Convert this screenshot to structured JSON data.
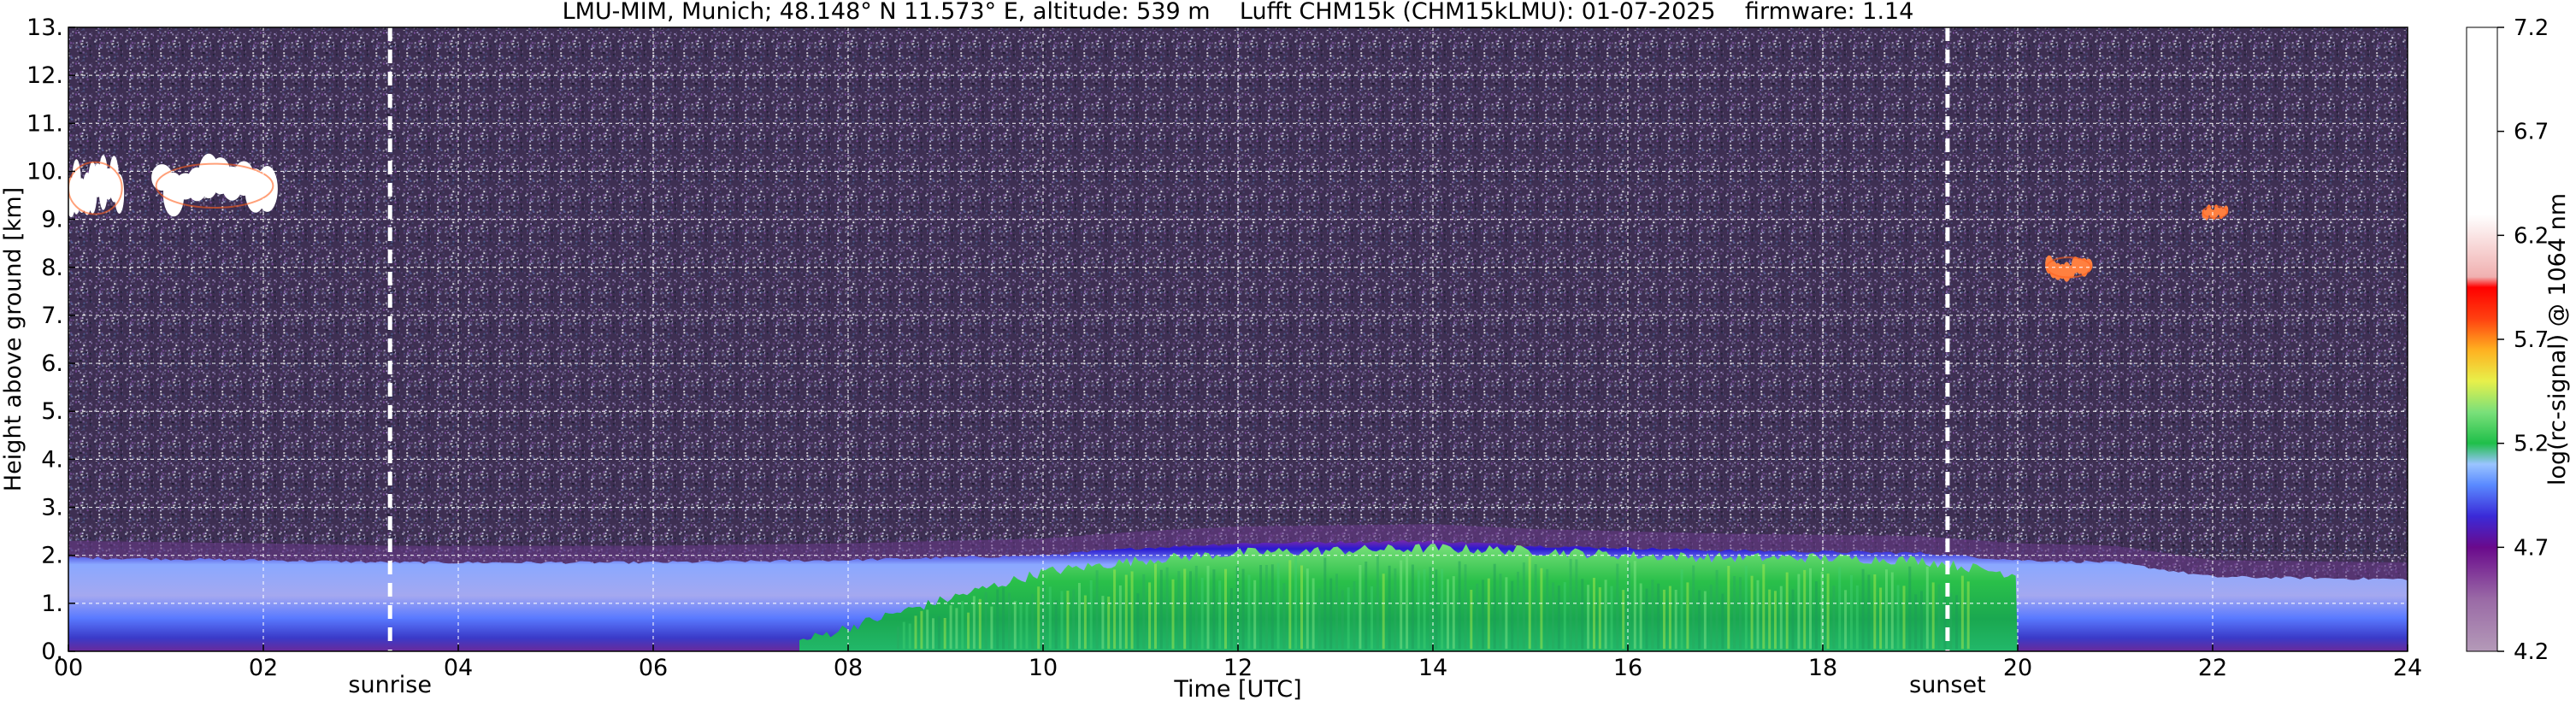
{
  "chart_data": {
    "type": "heatmap",
    "title": "LMU-MIM, Munich; 48.148° N 11.573° E, altitude: 539 m    Lufft CHM15k (CHM15kLMU): 01-07-2025    firmware: 1.14",
    "xlabel": "Time [UTC]",
    "ylabel": "Height above ground [km]",
    "colorbar_label": "log(rc-signal) @ 1064 nm",
    "xlim": [
      0,
      24
    ],
    "ylim": [
      0,
      13
    ],
    "x_ticks": [
      0,
      2,
      4,
      6,
      8,
      10,
      12,
      14,
      16,
      18,
      20,
      22,
      24
    ],
    "x_tick_labels": [
      "00",
      "02",
      "04",
      "06",
      "08",
      "10",
      "12",
      "14",
      "16",
      "18",
      "20",
      "22",
      "24"
    ],
    "y_ticks": [
      0,
      1,
      2,
      3,
      4,
      5,
      6,
      7,
      8,
      9,
      10,
      11,
      12,
      13
    ],
    "y_tick_labels": [
      "0.",
      "1.",
      "2.",
      "3.",
      "4.",
      "5.",
      "6.",
      "7.",
      "8.",
      "9.",
      "10.",
      "11.",
      "12.",
      "13."
    ],
    "grid": true,
    "colorbar": {
      "range": [
        4.2,
        7.2
      ],
      "ticks": [
        4.2,
        4.7,
        5.2,
        5.7,
        6.2,
        6.7,
        7.2
      ],
      "tick_labels": [
        "4.2",
        "4.7",
        "5.2",
        "5.7",
        "6.2",
        "6.7",
        "7.2"
      ],
      "stops": [
        {
          "value": 4.2,
          "color": "#b49ab8"
        },
        {
          "value": 4.45,
          "color": "#9a6aa6"
        },
        {
          "value": 4.7,
          "color": "#6a0a8c"
        },
        {
          "value": 4.85,
          "color": "#3a2ad8"
        },
        {
          "value": 5.0,
          "color": "#5a8aff"
        },
        {
          "value": 5.1,
          "color": "#9ac4ff"
        },
        {
          "value": 5.2,
          "color": "#1fbf4a"
        },
        {
          "value": 5.35,
          "color": "#7ae07a"
        },
        {
          "value": 5.5,
          "color": "#e8f04a"
        },
        {
          "value": 5.65,
          "color": "#ffb020"
        },
        {
          "value": 5.8,
          "color": "#ff4010"
        },
        {
          "value": 5.95,
          "color": "#ff0000"
        },
        {
          "value": 6.0,
          "color": "#f0b0b0"
        },
        {
          "value": 6.3,
          "color": "#ffffff"
        },
        {
          "value": 7.2,
          "color": "#ffffff"
        }
      ]
    },
    "markers": [
      {
        "label": "sunrise",
        "x": 3.3
      },
      {
        "label": "sunset",
        "x": 19.28
      }
    ],
    "features": {
      "background_noise": {
        "x": [
          0,
          24
        ],
        "y": [
          2.2,
          13
        ],
        "value": 4.5
      },
      "boundary_layer_top_km": {
        "x": [
          0,
          2,
          3.3,
          6,
          8,
          10,
          11,
          12,
          14,
          15,
          17,
          19,
          20,
          21,
          22,
          24
        ],
        "y": [
          1.95,
          1.9,
          1.85,
          1.85,
          1.9,
          2.0,
          2.15,
          2.25,
          2.3,
          2.2,
          2.1,
          2.05,
          1.9,
          1.85,
          1.55,
          1.5
        ]
      },
      "mixed_layer_top_km": {
        "x": [
          7.5,
          8.5,
          10,
          11,
          12,
          13,
          14,
          15,
          16,
          17,
          18,
          19,
          20
        ],
        "y": [
          0.2,
          0.8,
          1.65,
          1.9,
          2.05,
          2.1,
          2.15,
          2.1,
          2.0,
          1.95,
          1.95,
          1.9,
          1.6
        ]
      },
      "clouds": [
        {
          "x": [
            0.0,
            0.55
          ],
          "y": [
            9.0,
            10.3
          ],
          "value": 6.5
        },
        {
          "x": [
            0.9,
            2.1
          ],
          "y": [
            9.15,
            10.25
          ],
          "value": 7.0
        },
        {
          "x": [
            20.3,
            20.75
          ],
          "y": [
            7.75,
            8.25
          ],
          "value": 6.0
        },
        {
          "x": [
            21.9,
            22.15
          ],
          "y": [
            9.0,
            9.3
          ],
          "value": 6.0
        }
      ]
    }
  }
}
